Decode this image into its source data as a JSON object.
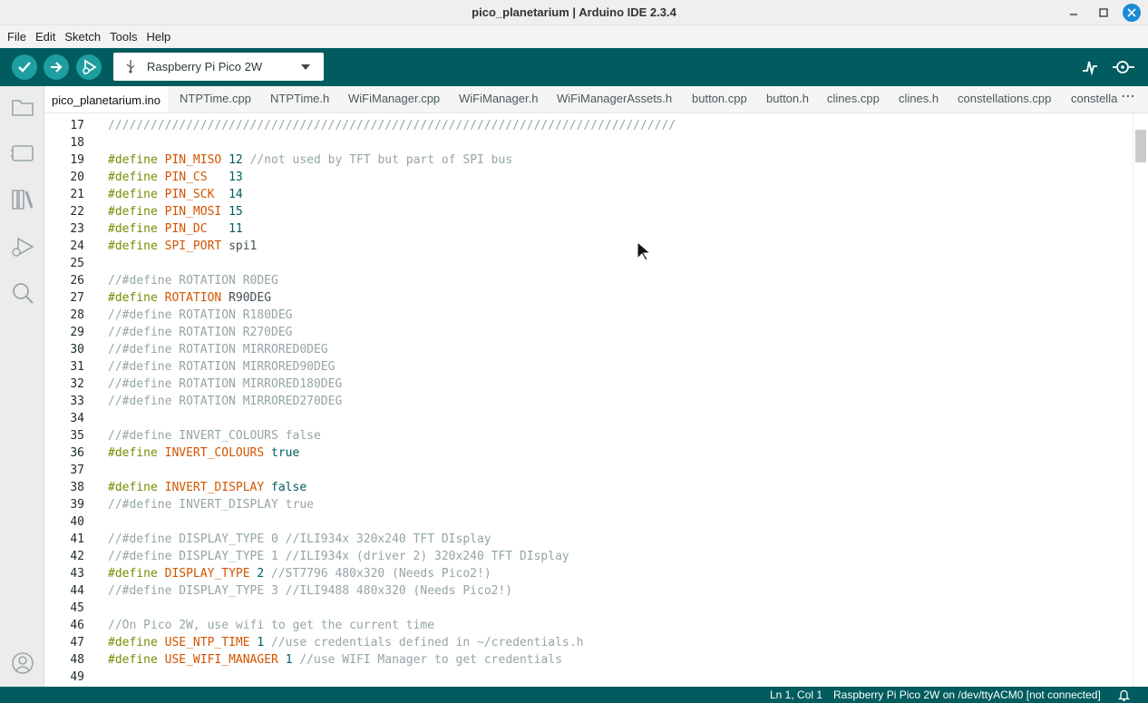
{
  "window": {
    "title": "pico_planetarium | Arduino IDE 2.3.4"
  },
  "menu": [
    "File",
    "Edit",
    "Sketch",
    "Tools",
    "Help"
  ],
  "toolbar": {
    "board": "Raspberry Pi Pico 2W"
  },
  "tabs": [
    "pico_planetarium.ino",
    "NTPTime.cpp",
    "NTPTime.h",
    "WiFiManager.cpp",
    "WiFiManager.h",
    "WiFiManagerAssets.h",
    "button.cpp",
    "button.h",
    "clines.cpp",
    "clines.h",
    "constellations.cpp",
    "constella"
  ],
  "editor": {
    "lines": [
      {
        "n": "17",
        "parts": [
          [
            "cm",
            "////////////////////////////////////////////////////////////////////////////////"
          ]
        ]
      },
      {
        "n": "18",
        "parts": []
      },
      {
        "n": "19",
        "parts": [
          [
            "kw",
            "#define"
          ],
          [
            "tx",
            " "
          ],
          [
            "nm",
            "PIN_MISO"
          ],
          [
            "tx",
            " "
          ],
          [
            "num",
            "12"
          ],
          [
            "tx",
            " "
          ],
          [
            "cm",
            "//not used by TFT but part of SPI bus"
          ]
        ]
      },
      {
        "n": "20",
        "parts": [
          [
            "kw",
            "#define"
          ],
          [
            "tx",
            " "
          ],
          [
            "nm",
            "PIN_CS"
          ],
          [
            "tx",
            "   "
          ],
          [
            "num",
            "13"
          ]
        ]
      },
      {
        "n": "21",
        "parts": [
          [
            "kw",
            "#define"
          ],
          [
            "tx",
            " "
          ],
          [
            "nm",
            "PIN_SCK"
          ],
          [
            "tx",
            "  "
          ],
          [
            "num",
            "14"
          ]
        ]
      },
      {
        "n": "22",
        "parts": [
          [
            "kw",
            "#define"
          ],
          [
            "tx",
            " "
          ],
          [
            "nm",
            "PIN_MOSI"
          ],
          [
            "tx",
            " "
          ],
          [
            "num",
            "15"
          ]
        ]
      },
      {
        "n": "23",
        "parts": [
          [
            "kw",
            "#define"
          ],
          [
            "tx",
            " "
          ],
          [
            "nm",
            "PIN_DC"
          ],
          [
            "tx",
            "   "
          ],
          [
            "num",
            "11"
          ]
        ]
      },
      {
        "n": "24",
        "parts": [
          [
            "kw",
            "#define"
          ],
          [
            "tx",
            " "
          ],
          [
            "nm",
            "SPI_PORT"
          ],
          [
            "tx",
            " spi1"
          ]
        ]
      },
      {
        "n": "25",
        "parts": []
      },
      {
        "n": "26",
        "parts": [
          [
            "cm",
            "//#define ROTATION R0DEG"
          ]
        ]
      },
      {
        "n": "27",
        "parts": [
          [
            "kw",
            "#define"
          ],
          [
            "tx",
            " "
          ],
          [
            "nm",
            "ROTATION"
          ],
          [
            "tx",
            " R90DEG"
          ]
        ]
      },
      {
        "n": "28",
        "parts": [
          [
            "cm",
            "//#define ROTATION R180DEG"
          ]
        ]
      },
      {
        "n": "29",
        "parts": [
          [
            "cm",
            "//#define ROTATION R270DEG"
          ]
        ]
      },
      {
        "n": "30",
        "parts": [
          [
            "cm",
            "//#define ROTATION MIRRORED0DEG"
          ]
        ]
      },
      {
        "n": "31",
        "parts": [
          [
            "cm",
            "//#define ROTATION MIRRORED90DEG"
          ]
        ]
      },
      {
        "n": "32",
        "parts": [
          [
            "cm",
            "//#define ROTATION MIRRORED180DEG"
          ]
        ]
      },
      {
        "n": "33",
        "parts": [
          [
            "cm",
            "//#define ROTATION MIRRORED270DEG"
          ]
        ]
      },
      {
        "n": "34",
        "parts": []
      },
      {
        "n": "35",
        "parts": [
          [
            "cm",
            "//#define INVERT_COLOURS false"
          ]
        ]
      },
      {
        "n": "36",
        "parts": [
          [
            "kw",
            "#define"
          ],
          [
            "tx",
            " "
          ],
          [
            "nm",
            "INVERT_COLOURS"
          ],
          [
            "tx",
            " "
          ],
          [
            "num",
            "true"
          ]
        ]
      },
      {
        "n": "37",
        "parts": []
      },
      {
        "n": "38",
        "parts": [
          [
            "kw",
            "#define"
          ],
          [
            "tx",
            " "
          ],
          [
            "nm",
            "INVERT_DISPLAY"
          ],
          [
            "tx",
            " "
          ],
          [
            "num",
            "false"
          ]
        ]
      },
      {
        "n": "39",
        "parts": [
          [
            "cm",
            "//#define INVERT_DISPLAY true"
          ]
        ]
      },
      {
        "n": "40",
        "parts": []
      },
      {
        "n": "41",
        "parts": [
          [
            "cm",
            "//#define DISPLAY_TYPE 0 //ILI934x 320x240 TFT DIsplay"
          ]
        ]
      },
      {
        "n": "42",
        "parts": [
          [
            "cm",
            "//#define DISPLAY_TYPE 1 //ILI934x (driver 2) 320x240 TFT DIsplay"
          ]
        ]
      },
      {
        "n": "43",
        "parts": [
          [
            "kw",
            "#define"
          ],
          [
            "tx",
            " "
          ],
          [
            "nm",
            "DISPLAY_TYPE"
          ],
          [
            "tx",
            " "
          ],
          [
            "num",
            "2"
          ],
          [
            "tx",
            " "
          ],
          [
            "cm",
            "//ST7796 480x320 (Needs Pico2!)"
          ]
        ]
      },
      {
        "n": "44",
        "parts": [
          [
            "cm",
            "//#define DISPLAY_TYPE 3 //ILI9488 480x320 (Needs Pico2!)"
          ]
        ]
      },
      {
        "n": "45",
        "parts": []
      },
      {
        "n": "46",
        "parts": [
          [
            "cm",
            "//On Pico 2W, use wifi to get the current time"
          ]
        ]
      },
      {
        "n": "47",
        "parts": [
          [
            "kw",
            "#define"
          ],
          [
            "tx",
            " "
          ],
          [
            "nm",
            "USE_NTP_TIME"
          ],
          [
            "tx",
            " "
          ],
          [
            "num",
            "1"
          ],
          [
            "tx",
            " "
          ],
          [
            "cm",
            "//use credentials defined in ~/credentials.h"
          ]
        ]
      },
      {
        "n": "48",
        "parts": [
          [
            "kw",
            "#define"
          ],
          [
            "tx",
            " "
          ],
          [
            "nm",
            "USE_WIFI_MANAGER"
          ],
          [
            "tx",
            " "
          ],
          [
            "num",
            "1"
          ],
          [
            "tx",
            " "
          ],
          [
            "cm",
            "//use WIFI Manager to get credentials"
          ]
        ]
      },
      {
        "n": "49",
        "parts": []
      }
    ]
  },
  "status": {
    "position": "Ln 1, Col 1",
    "board": "Raspberry Pi Pico 2W on /dev/ttyACM0 [not connected]"
  },
  "colors": {
    "teal": "#005c5f",
    "keyword": "#728e00",
    "name": "#d35400",
    "comment": "#95a5a6"
  }
}
